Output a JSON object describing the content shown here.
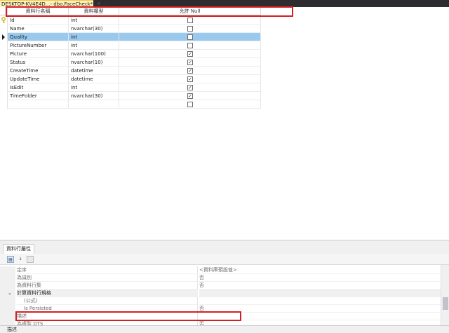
{
  "tab": {
    "title": "DESKTOP-KV4E4D...- dbo.FaceCheck*",
    "pin_glyph": "⊕",
    "close_glyph": "✕"
  },
  "grid": {
    "headers": [
      "資料行名稱",
      "資料類型",
      "允許 Null"
    ],
    "rows": [
      {
        "name": "Id",
        "type": "int",
        "allow_null": false,
        "key": true
      },
      {
        "name": "Name",
        "type": "nvarchar(30)",
        "allow_null": false
      },
      {
        "name": "Quality",
        "type": "int",
        "allow_null": false,
        "selected": true
      },
      {
        "name": "PictureNumber",
        "type": "int",
        "allow_null": false
      },
      {
        "name": "Picture",
        "type": "nvarchar(100)",
        "allow_null": true
      },
      {
        "name": "Status",
        "type": "nvarchar(10)",
        "allow_null": true
      },
      {
        "name": "CreateTime",
        "type": "datetime",
        "allow_null": true
      },
      {
        "name": "UpdateTime",
        "type": "datetime",
        "allow_null": true
      },
      {
        "name": "IsEdit",
        "type": "int",
        "allow_null": true
      },
      {
        "name": "TimeFolder",
        "type": "nvarchar(30)",
        "allow_null": true
      },
      {
        "name": "",
        "type": "",
        "allow_null": false
      }
    ]
  },
  "properties": {
    "tab_label": "資料行屬性",
    "rows": [
      {
        "name": "定序",
        "value": "<資料庫預設值>"
      },
      {
        "name": "為識別",
        "value": "否"
      },
      {
        "name": "為資料行集",
        "value": "否"
      },
      {
        "name": "計算資料行規格",
        "value": "",
        "category": true,
        "expanded": true
      },
      {
        "name": "(公式)",
        "value": "",
        "indent": true
      },
      {
        "name": "Is Persisted",
        "value": "否",
        "indent": true
      },
      {
        "name": "描述",
        "value": ""
      },
      {
        "name": "為複製 DTS",
        "value": "否"
      }
    ],
    "description_label": "描述"
  },
  "colors": {
    "selection": "#99c9ef",
    "annotation_red": "#d51f24",
    "tab_background": "#fff1b8"
  }
}
